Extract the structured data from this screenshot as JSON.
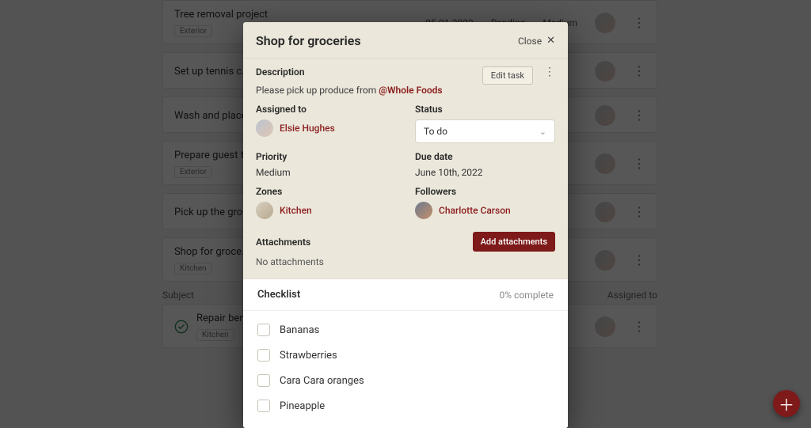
{
  "background": {
    "columns": {
      "subject": "Subject",
      "assigned": "Assigned to"
    },
    "cards": [
      {
        "title": "Tree removal project",
        "tag": "Exterior",
        "date": "05-01-2022",
        "status": "Pending",
        "priority": "Medium"
      },
      {
        "title": "Set up tennis c…",
        "tag": ""
      },
      {
        "title": "Wash and place…",
        "tag": ""
      },
      {
        "title": "Prepare guest t…",
        "tag": "Exterior"
      },
      {
        "title": "Pick up the gro… Whole Foods",
        "tag": ""
      },
      {
        "title": "Shop for groce…",
        "tag": "Kitchen"
      }
    ],
    "lower_card": {
      "title": "Repair ben…",
      "tag": "Kitchen"
    }
  },
  "modal": {
    "title": "Shop for groceries",
    "close_label": "Close",
    "description": {
      "label": "Description",
      "text_prefix": "Please pick up produce from ",
      "mention": "@Whole Foods",
      "edit_label": "Edit task"
    },
    "assigned": {
      "label": "Assigned to",
      "name": "Elsie Hughes"
    },
    "status": {
      "label": "Status",
      "value": "To do"
    },
    "priority": {
      "label": "Priority",
      "value": "Medium"
    },
    "due": {
      "label": "Due date",
      "value": "June 10th, 2022"
    },
    "zones": {
      "label": "Zones",
      "name": "Kitchen"
    },
    "followers": {
      "label": "Followers",
      "name": "Charlotte Carson"
    },
    "attachments": {
      "label": "Attachments",
      "none": "No attachments",
      "add": "Add attachments"
    },
    "checklist": {
      "title": "Checklist",
      "progress": "0% complete",
      "items": [
        "Bananas",
        "Strawberries",
        "Cara Cara oranges",
        "Pineapple"
      ]
    }
  }
}
